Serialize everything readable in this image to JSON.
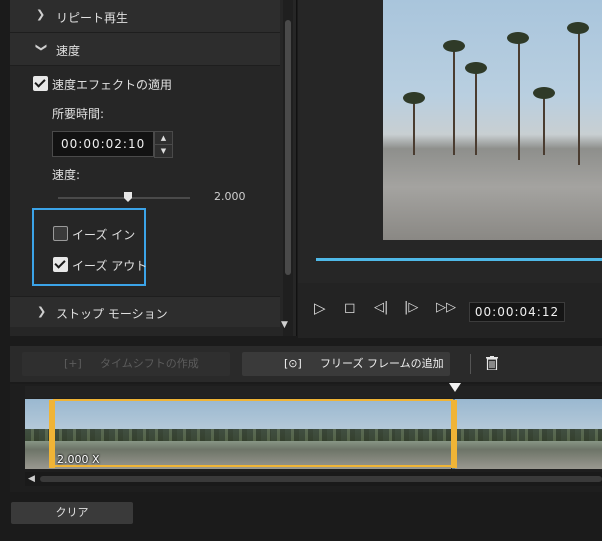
{
  "left_panel": {
    "repeat_label": "リピート再生",
    "speed_section_label": "速度",
    "apply_speed_effect_label": "速度エフェクトの適用",
    "apply_speed_effect_checked": true,
    "duration_label": "所要時間:",
    "duration_value": "00:00:02:10",
    "speed_label": "速度:",
    "speed_value": "2.000",
    "ease_in_label": "イーズ イン",
    "ease_in_checked": false,
    "ease_out_label": "イーズ アウト",
    "ease_out_checked": true,
    "stop_motion_label": "ストップ モーション"
  },
  "preview": {
    "timecode": "00:00:04:12"
  },
  "toolbar": {
    "time_shift_label": "タイムシフトの作成",
    "freeze_frame_label": "フリーズ フレームの追加"
  },
  "timeline": {
    "clip_speed_label": "2.000 X"
  },
  "footer": {
    "clear_label": "クリア"
  },
  "colors": {
    "accent_blue": "#3ba3e8",
    "selection_orange": "#f0b436",
    "progress_blue": "#4fb9e8"
  }
}
